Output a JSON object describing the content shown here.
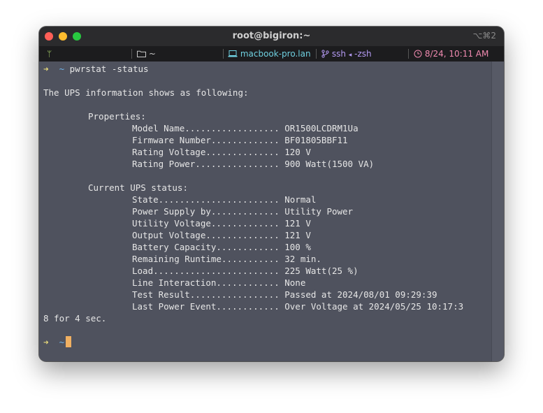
{
  "window": {
    "title": "root@bigiron:~",
    "shortcut": "⌥⌘2"
  },
  "statusbar": {
    "git_icon_glyph": "ᛘ",
    "dir_icon": "folder-icon",
    "dir": "~",
    "host_icon": "laptop-icon",
    "host": "macbook-pro.lan",
    "job_icon": "branch-icon",
    "job": "ssh",
    "job_arrow": "◂",
    "job_shell": "-zsh",
    "clock_icon": "clock-icon",
    "clock": "8/24, 10:11 AM"
  },
  "prompt": {
    "arrow": "➜",
    "tilde": "~",
    "command": "pwrstat -status"
  },
  "output": {
    "intro": "The UPS information shows as following:",
    "properties_header": "Properties:",
    "properties": [
      {
        "label": "Model Name..................",
        "value": "OR1500LCDRM1Ua"
      },
      {
        "label": "Firmware Number.............",
        "value": "BF01805BBF11"
      },
      {
        "label": "Rating Voltage..............",
        "value": "120 V"
      },
      {
        "label": "Rating Power................",
        "value": "900 Watt(1500 VA)"
      }
    ],
    "status_header": "Current UPS status:",
    "status": [
      {
        "label": "State.......................",
        "value": "Normal"
      },
      {
        "label": "Power Supply by.............",
        "value": "Utility Power"
      },
      {
        "label": "Utility Voltage.............",
        "value": "121 V"
      },
      {
        "label": "Output Voltage..............",
        "value": "121 V"
      },
      {
        "label": "Battery Capacity............",
        "value": "100 %"
      },
      {
        "label": "Remaining Runtime...........",
        "value": "32 min."
      },
      {
        "label": "Load........................",
        "value": "225 Watt(25 %)"
      },
      {
        "label": "Line Interaction............",
        "value": "None"
      },
      {
        "label": "Test Result.................",
        "value": "Passed at 2024/08/01 09:29:39"
      },
      {
        "label": "Last Power Event............",
        "value": "Over Voltage at 2024/05/25 10:17:3"
      }
    ],
    "wrap": "8 for 4 sec."
  },
  "colors": {
    "terminal_bg": "#4f525e",
    "titlebar_bg": "#2b2b2d",
    "statusbar_bg": "#1c1c1e",
    "cursor": "#f0b062"
  }
}
